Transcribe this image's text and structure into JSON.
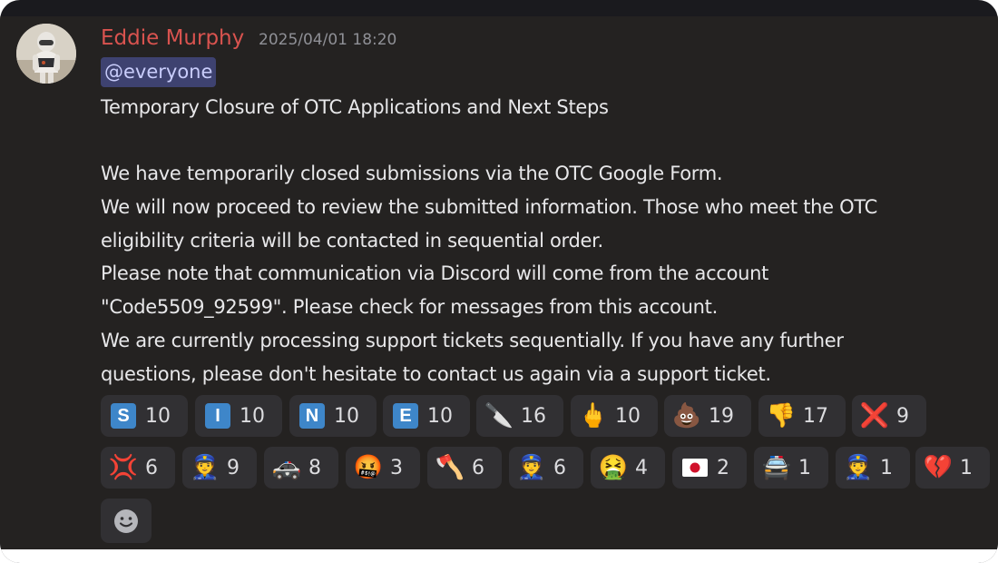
{
  "message": {
    "author": "Eddie Murphy",
    "timestamp": "2025/04/01 18:20",
    "mention": "@everyone",
    "lines": [
      "Temporary Closure of OTC Applications and Next Steps",
      "",
      "We have temporarily closed submissions via the OTC Google Form.",
      "We will now proceed to review the submitted information. Those who meet the OTC",
      "eligibility criteria will be contacted in sequential order.",
      "Please note that communication via Discord will come from the account",
      "\"Code5509_92599\". Please check for messages from this account.",
      "We are currently processing support tickets sequentially. If you have any further",
      "questions, please don't hesitate to contact us again via a support ticket."
    ]
  },
  "reactions": [
    {
      "icon": "regional-indicator-s-icon",
      "letter": "S",
      "count": "10"
    },
    {
      "icon": "regional-indicator-i-icon",
      "letter": "I",
      "count": "10"
    },
    {
      "icon": "regional-indicator-n-icon",
      "letter": "N",
      "count": "10"
    },
    {
      "icon": "regional-indicator-e-icon",
      "letter": "E",
      "count": "10"
    },
    {
      "icon": "knife-icon",
      "emoji": "🔪",
      "count": "16"
    },
    {
      "icon": "middle-finger-icon",
      "emoji": "🖕",
      "count": "10"
    },
    {
      "icon": "pile-of-poo-icon",
      "emoji": "💩",
      "count": "19"
    },
    {
      "icon": "thumbs-down-icon",
      "emoji": "👎",
      "count": "17"
    },
    {
      "icon": "cross-mark-icon",
      "emoji": "❌",
      "count": "9"
    },
    {
      "icon": "anger-symbol-icon",
      "emoji": "💢",
      "count": "6"
    },
    {
      "icon": "police-officer-icon",
      "emoji": "👮",
      "count": "9"
    },
    {
      "icon": "police-car-icon",
      "emoji": "🚓",
      "count": "8"
    },
    {
      "icon": "swearing-face-icon",
      "emoji": "🤬",
      "count": "3"
    },
    {
      "icon": "axe-icon",
      "emoji": "🪓",
      "count": "6"
    },
    {
      "icon": "woman-police-officer-icon",
      "emoji": "👮",
      "count": "6"
    },
    {
      "icon": "vomiting-face-icon",
      "emoji": "🤮",
      "count": "4"
    },
    {
      "icon": "japan-flag-icon",
      "emoji": "🇯🇵",
      "count": "2"
    },
    {
      "icon": "oncoming-police-car-icon",
      "emoji": "🚔",
      "count": "1"
    },
    {
      "icon": "police-officer-icon",
      "emoji": "👮",
      "count": "1"
    },
    {
      "icon": "broken-heart-icon",
      "emoji": "💔",
      "count": "1"
    }
  ],
  "colors": {
    "background": "#242221",
    "author": "#d9534f",
    "mention_bg": "#3e4270",
    "regional_indicator": "#3e86c9",
    "reaction_bg": "#313033"
  }
}
